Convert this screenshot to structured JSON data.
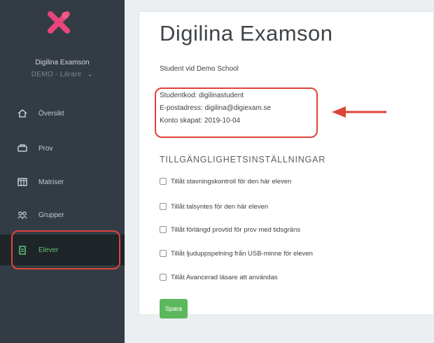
{
  "sidebar": {
    "user_name": "Digilina Examson",
    "user_role": "DEMO - Lärare",
    "items": [
      {
        "label": "Översikt",
        "icon": "home-icon"
      },
      {
        "label": "Prov",
        "icon": "exam-icon"
      },
      {
        "label": "Matriser",
        "icon": "grid-icon"
      },
      {
        "label": "Grupper",
        "icon": "group-icon"
      },
      {
        "label": "Elever",
        "icon": "student-icon",
        "active": true
      }
    ]
  },
  "main": {
    "title": "Digilina Examson",
    "subtitle": "Student vid Demo School",
    "info": {
      "student_code": "Studentkod: digilinastudent",
      "email": "E-postadress: digilina@digiexam.se",
      "created": "Konto skapat: 2019-10-04"
    },
    "accessibility_heading": "TILLGÄNGLIGHETSINSTÄLLNINGAR",
    "settings": [
      {
        "label": "Tillåt stavningskontroll för den här eleven",
        "checked": false
      },
      {
        "label": "Tillåt talsyntes för den här eleven",
        "checked": false
      },
      {
        "label": "Tillåt förlängd provtid för prov med tidsgräns",
        "checked": false
      },
      {
        "label": "Tillåt ljuduppspelning från USB-minne för eleven",
        "checked": false
      },
      {
        "label": "Tillåt Avancerad läsare att användas",
        "checked": false
      }
    ],
    "save_label": "Spara"
  },
  "colors": {
    "sidebar_bg": "#333c44",
    "active_accent": "#5cc07a",
    "annotation_red": "#e0433a",
    "logo_pink": "#e8457d",
    "save_green": "#5cb85c"
  }
}
